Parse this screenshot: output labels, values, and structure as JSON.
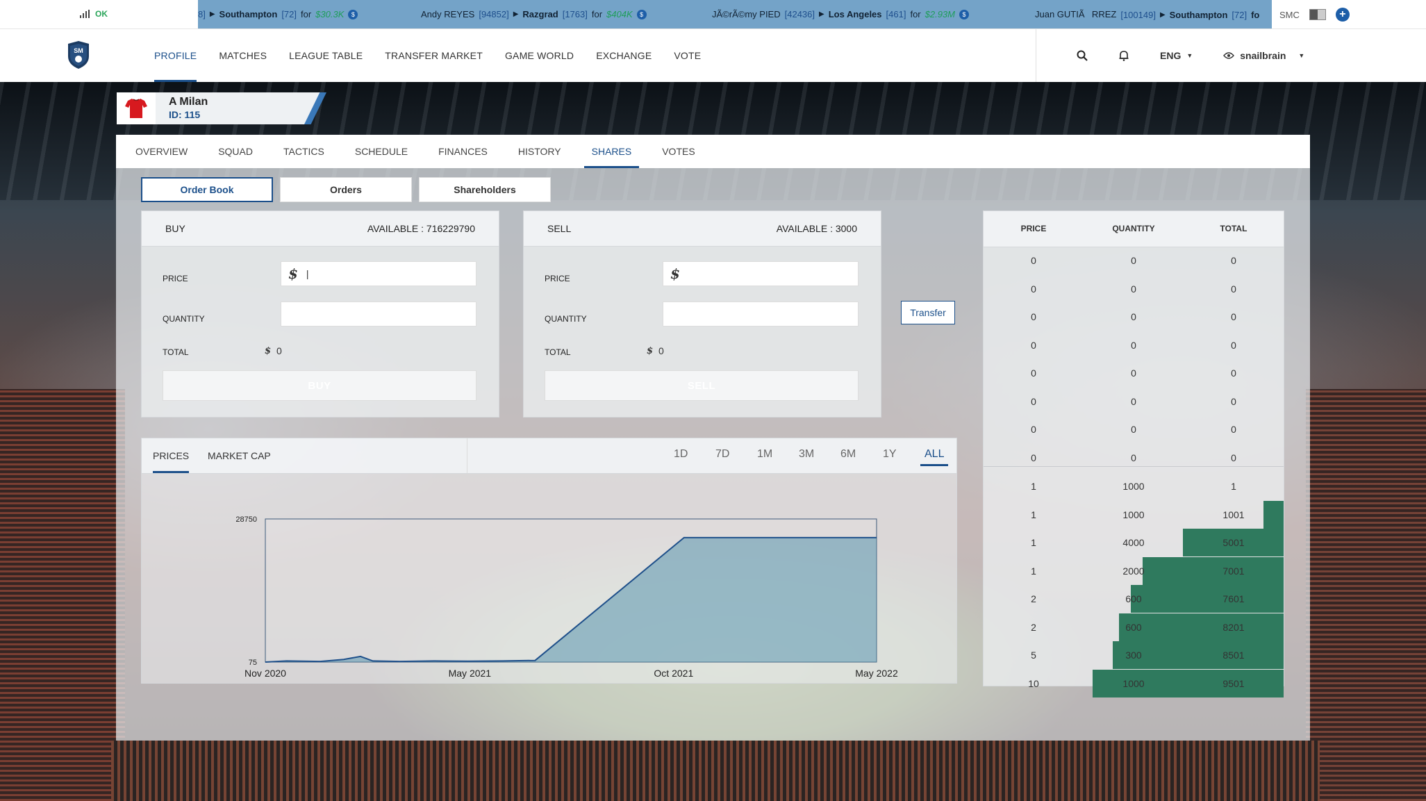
{
  "ticker": {
    "status": "OK",
    "items": [
      {
        "name": "",
        "id": "8]",
        "team": "Southampton",
        "team_id": "[72]",
        "for": "for",
        "amount": "$30.3K"
      },
      {
        "name": "Andy REYES",
        "id": "[94852]",
        "team": "Razgrad",
        "team_id": "[1763]",
        "for": "for",
        "amount": "$404K"
      },
      {
        "name": "JÃ©rÃ©my PIED",
        "id": "[42436]",
        "team": "Los Angeles",
        "team_id": "[461]",
        "for": "for",
        "amount": "$2.93M"
      },
      {
        "name": "Juan GUTIÃRREZ",
        "id": "[100149]",
        "team": "Southampton",
        "team_id": "[72]",
        "for": "fo",
        "amount": ""
      }
    ],
    "currency": "SMC"
  },
  "nav": {
    "links": [
      "PROFILE",
      "MATCHES",
      "LEAGUE TABLE",
      "TRANSFER MARKET",
      "GAME WORLD",
      "EXCHANGE",
      "VOTE"
    ],
    "active": "PROFILE",
    "language": "ENG",
    "username": "snailbrain",
    "logo_text": "SM"
  },
  "club": {
    "name": "A Milan",
    "id_label": "ID: 115"
  },
  "tabs": [
    "OVERVIEW",
    "SQUAD",
    "TACTICS",
    "SCHEDULE",
    "FINANCES",
    "HISTORY",
    "SHARES",
    "VOTES"
  ],
  "active_tab": "SHARES",
  "subtabs": [
    "Order Book",
    "Orders",
    "Shareholders"
  ],
  "buy": {
    "title": "BUY",
    "available": "AVAILABLE : 716229790",
    "price_label": "PRICE",
    "price_value": "|",
    "quantity_label": "QUANTITY",
    "quantity_value": "",
    "total_label": "TOTAL",
    "total_value": "0",
    "button": "BUY"
  },
  "sell": {
    "title": "SELL",
    "available": "AVAILABLE : 3000",
    "price_label": "PRICE",
    "price_value": "",
    "quantity_label": "QUANTITY",
    "quantity_value": "",
    "total_label": "TOTAL",
    "total_value": "0",
    "button": "SELL"
  },
  "transfer_button": "Transfer",
  "chart_tabs": [
    "PRICES",
    "MARKET CAP"
  ],
  "active_chart_tab": "PRICES",
  "ranges": [
    "1D",
    "7D",
    "1M",
    "3M",
    "6M",
    "1Y",
    "ALL"
  ],
  "active_range": "ALL",
  "chart_data": {
    "type": "area",
    "title": "",
    "xlabel": "",
    "ylabel": "",
    "x_ticks": [
      "Nov 2020",
      "May 2021",
      "Oct 2021",
      "May 2022"
    ],
    "y_ticks": [
      "28750",
      "75"
    ],
    "ylim": [
      75,
      28750
    ],
    "xlim": [
      "2020-11-01",
      "2022-05-01"
    ],
    "series": [
      {
        "color": "#1e4f8a",
        "points": [
          {
            "x": "2020-11-01",
            "y": 75
          },
          {
            "x": "2020-11-20",
            "y": 300
          },
          {
            "x": "2020-12-20",
            "y": 200
          },
          {
            "x": "2021-01-10",
            "y": 600
          },
          {
            "x": "2021-01-25",
            "y": 1200
          },
          {
            "x": "2021-02-05",
            "y": 300
          },
          {
            "x": "2021-03-01",
            "y": 200
          },
          {
            "x": "2021-04-01",
            "y": 300
          },
          {
            "x": "2021-05-01",
            "y": 250
          },
          {
            "x": "2021-06-01",
            "y": 300
          },
          {
            "x": "2021-06-30",
            "y": 400
          },
          {
            "x": "2021-11-10",
            "y": 25000
          },
          {
            "x": "2022-05-01",
            "y": 25000
          }
        ]
      }
    ]
  },
  "book": {
    "headers": [
      "PRICE",
      "QUANTITY",
      "TOTAL"
    ],
    "bids": [
      {
        "price": "0",
        "quantity": "0",
        "total": "0"
      },
      {
        "price": "0",
        "quantity": "0",
        "total": "0"
      },
      {
        "price": "0",
        "quantity": "0",
        "total": "0"
      },
      {
        "price": "0",
        "quantity": "0",
        "total": "0"
      },
      {
        "price": "0",
        "quantity": "0",
        "total": "0"
      },
      {
        "price": "0",
        "quantity": "0",
        "total": "0"
      },
      {
        "price": "0",
        "quantity": "0",
        "total": "0"
      },
      {
        "price": "0",
        "quantity": "0",
        "total": "0"
      }
    ],
    "asks": [
      {
        "price": "1",
        "quantity": "1000",
        "total": "1",
        "depth": 0.0
      },
      {
        "price": "1",
        "quantity": "1000",
        "total": "1001",
        "depth": 0.105
      },
      {
        "price": "1",
        "quantity": "4000",
        "total": "5001",
        "depth": 0.526
      },
      {
        "price": "1",
        "quantity": "2000",
        "total": "7001",
        "depth": 0.737
      },
      {
        "price": "2",
        "quantity": "600",
        "total": "7601",
        "depth": 0.8
      },
      {
        "price": "2",
        "quantity": "600",
        "total": "8201",
        "depth": 0.863
      },
      {
        "price": "5",
        "quantity": "300",
        "total": "8501",
        "depth": 0.894
      },
      {
        "price": "10",
        "quantity": "1000",
        "total": "9501",
        "depth": 1.0
      }
    ]
  }
}
